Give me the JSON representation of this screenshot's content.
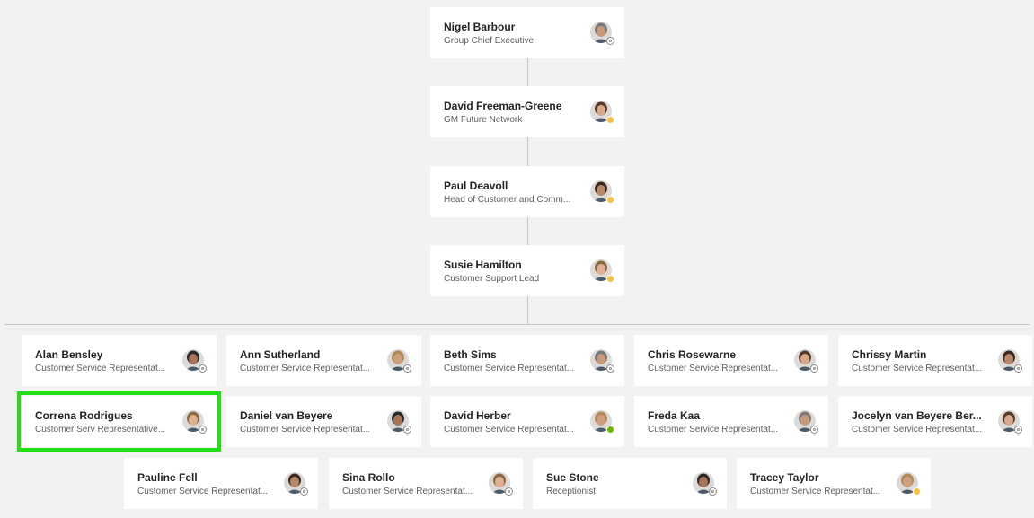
{
  "chain": [
    {
      "name": "Nigel Barbour",
      "title": "Group Chief Executive",
      "avatar": "person-photo-grey-hair",
      "presence": "offline"
    },
    {
      "name": "David Freeman-Greene",
      "title": "GM Future Network",
      "avatar": "person-photo",
      "presence": "away"
    },
    {
      "name": "Paul Deavoll",
      "title": "Head of Customer and Comm...",
      "avatar": "person-photo",
      "presence": "away"
    },
    {
      "name": "Susie Hamilton",
      "title": "Customer Support Lead",
      "avatar": "person-photo",
      "presence": "away"
    }
  ],
  "reports": [
    {
      "name": "Alan Bensley",
      "title": "Customer Service Representat...",
      "avatar": "person-photo",
      "presence": "offline"
    },
    {
      "name": "Ann Sutherland",
      "title": "Customer Service Representat...",
      "avatar": "person-photo",
      "presence": "offline"
    },
    {
      "name": "Beth Sims",
      "title": "Customer Service Representat...",
      "avatar": "person-photo",
      "presence": "offline"
    },
    {
      "name": "Chris Rosewarne",
      "title": "Customer Service Representat...",
      "avatar": "person-photo",
      "presence": "offline"
    },
    {
      "name": "Chrissy Martin",
      "title": "Customer Service Representat...",
      "avatar": "person-photo",
      "presence": "offline"
    },
    {
      "name": "Correna Rodrigues",
      "title": "Customer Serv Representative...",
      "avatar": "person-photo",
      "presence": "offline",
      "selected": true
    },
    {
      "name": "Daniel van Beyere",
      "title": "Customer Service Representat...",
      "avatar": "person-photo",
      "presence": "offline"
    },
    {
      "name": "David Herber",
      "title": "Customer Service Representat...",
      "avatar": "person-photo",
      "presence": "available"
    },
    {
      "name": "Freda Kaa",
      "title": "Customer Service Representat...",
      "avatar": "person-photo",
      "presence": "offline"
    },
    {
      "name": "Jocelyn van Beyere Ber...",
      "title": "Customer Service Representat...",
      "avatar": "person-photo",
      "presence": "offline"
    },
    {
      "name": "Pauline Fell",
      "title": "Customer Service Representat...",
      "avatar": "person-photo",
      "presence": "offline"
    },
    {
      "name": "Sina Rollo",
      "title": "Customer Service Representat...",
      "avatar": "person-photo",
      "presence": "offline"
    },
    {
      "name": "Sue Stone",
      "title": "Receptionist",
      "avatar": "person-photo",
      "presence": "offline"
    },
    {
      "name": "Tracey Taylor",
      "title": "Customer Service Representat...",
      "avatar": "person-photo",
      "presence": "away"
    }
  ],
  "colors": {
    "selection_outline": "#22e016",
    "presence_away": "#f8c040",
    "presence_available": "#6bb700"
  }
}
